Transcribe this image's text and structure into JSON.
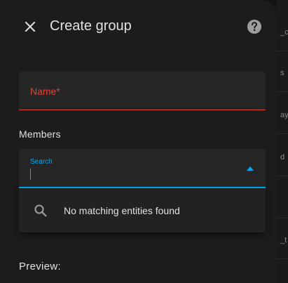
{
  "background": {
    "fragments": [
      "_c",
      "s",
      "ay",
      "d",
      "_t"
    ]
  },
  "dialog": {
    "title": "Create group",
    "close_icon": "close-icon",
    "help_icon": "help-circle-icon"
  },
  "form": {
    "name_field": {
      "label": "Name*",
      "value": ""
    },
    "members_label": "Members",
    "search": {
      "label": "Search",
      "value": "",
      "dropdown_icon": "menu-up-icon"
    },
    "suggestions": {
      "icon": "search-icon",
      "message": "No matching entities found"
    },
    "preview_label": "Preview:"
  },
  "colors": {
    "dialog_bg": "#1c1c1c",
    "field_bg": "#262626",
    "error": "#db4437",
    "accent": "#03a9f4",
    "text": "#e1e1e1"
  }
}
